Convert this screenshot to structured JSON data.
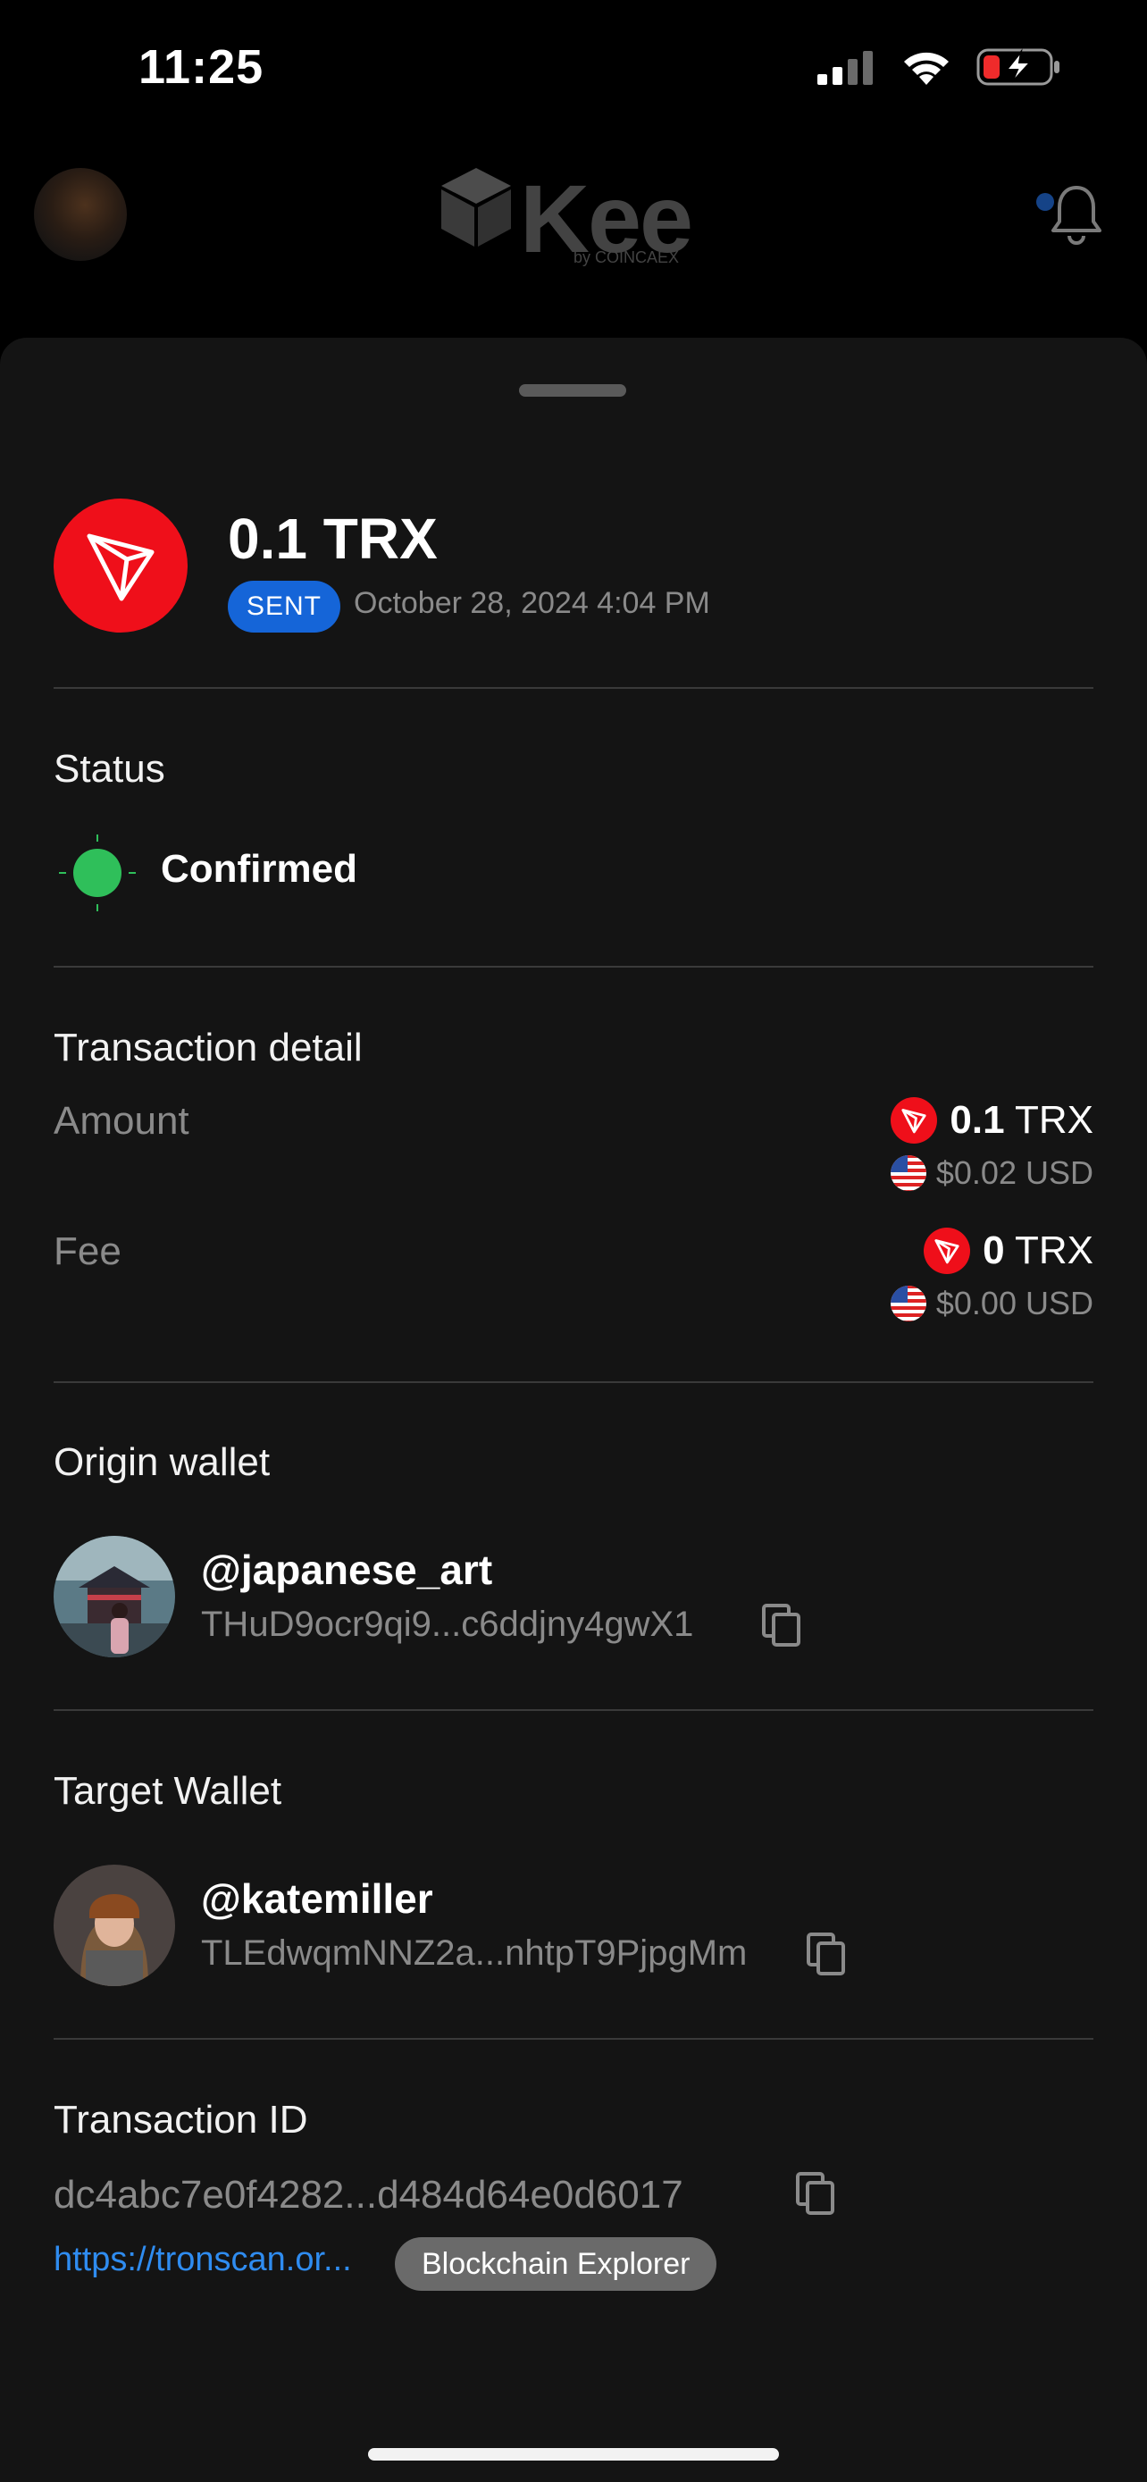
{
  "status_bar": {
    "time": "11:25"
  },
  "app_header": {
    "logo_text": "Kee",
    "logo_byline": "by COINCAEX"
  },
  "transaction": {
    "amount_title": "0.1 TRX",
    "direction_badge": "SENT",
    "datetime": "October 28, 2024 4:04 PM"
  },
  "status": {
    "title": "Status",
    "value": "Confirmed",
    "color": "#2fbf5a"
  },
  "detail": {
    "title": "Transaction detail",
    "amount_label": "Amount",
    "amount_value": "0.1",
    "amount_unit": "TRX",
    "amount_usd": "$0.02 USD",
    "fee_label": "Fee",
    "fee_value": "0",
    "fee_unit": "TRX",
    "fee_usd": "$0.00 USD"
  },
  "origin_wallet": {
    "title": "Origin wallet",
    "username": "@japanese_art",
    "address": "THuD9ocr9qi9...c6ddjny4gwX1"
  },
  "target_wallet": {
    "title": "Target Wallet",
    "username": "@katemiller",
    "address": "TLEdwqmNNZ2a...nhtpT9PjpgMm"
  },
  "transaction_id": {
    "title": "Transaction ID",
    "value": "dc4abc7e0f4282...d484d64e0d6017",
    "link": "https://tronscan.or...",
    "explorer_button": "Blockchain Explorer"
  },
  "colors": {
    "tron_red": "#ef0f1a",
    "badge_blue": "#1565d8",
    "link_blue": "#2f8cf0"
  }
}
